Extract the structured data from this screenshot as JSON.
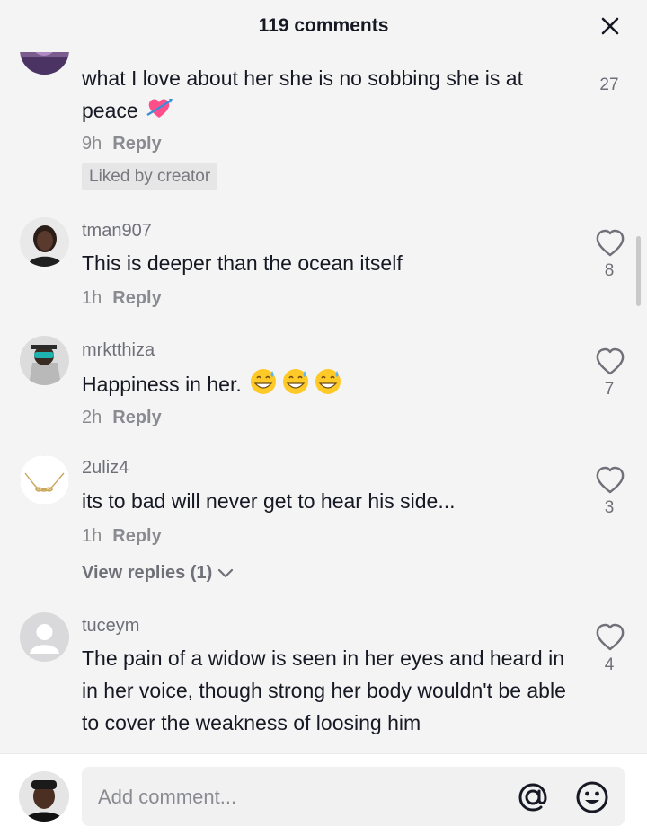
{
  "header": {
    "title": "119 comments",
    "close_icon": "close-icon"
  },
  "comments": [
    {
      "text": "what I love about her she is no sobbing she is at peace",
      "emoji": "heart-with-arrow",
      "time": "9h",
      "reply_label": "Reply",
      "badge": "Liked by creator",
      "likes": "27"
    },
    {
      "username": "tman907",
      "text": "This is deeper than the ocean itself",
      "time": "1h",
      "reply_label": "Reply",
      "likes": "8"
    },
    {
      "username": "mrktthiza",
      "text": "Happiness in her.",
      "emoji": "grinning-sweat x3",
      "time": "2h",
      "reply_label": "Reply",
      "likes": "7"
    },
    {
      "username": "2uliz4",
      "text": "its to bad will never get to hear his side...",
      "time": "1h",
      "reply_label": "Reply",
      "view_replies": "View replies (1)",
      "likes": "3"
    },
    {
      "username": "tuceym",
      "text": "The pain of a widow is seen in her eyes and heard in in her voice, though strong her body wouldn't be able to cover the weakness of loosing him",
      "likes": "4"
    }
  ],
  "input": {
    "placeholder": "Add comment...",
    "at_icon": "at-icon",
    "emoji_icon": "emoji-icon"
  },
  "colors": {
    "text": "#161823",
    "secondary": "#8a8b91",
    "background": "#f4f4f4",
    "badge_bg": "#e6e6e7"
  }
}
